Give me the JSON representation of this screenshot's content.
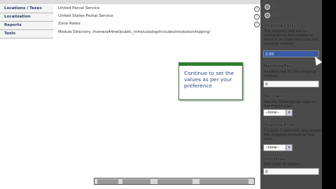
{
  "nav": {
    "items": [
      {
        "label": "Locations / Taxes"
      },
      {
        "label": "Localization"
      },
      {
        "label": "Reports"
      },
      {
        "label": "Tools"
      }
    ]
  },
  "modules": {
    "rows": [
      {
        "name": "United Parcel Service"
      },
      {
        "name": "United States Postal Service"
      },
      {
        "name": "Zone Rates"
      }
    ],
    "directory": "Module Directory: /home/a44net/public_html/catalog/includes/modules/shipping/"
  },
  "tooltip": {
    "text": "Continue to set the values as per your preference"
  },
  "sidepanel": {
    "radio1": "True",
    "radio2": "False",
    "shipping_cost_label": "Shipping Cost",
    "shipping_cost_desc": "The shipping cost will be multiplied by the number of items in an order that uses this shipping method.",
    "shipping_cost_value": "2.50",
    "handling_fee_label": "Handling Fee",
    "handling_fee_desc": "Handling fee for this shipping method.",
    "handling_fee_value": "0",
    "tax_class_label": "Tax Class",
    "tax_class_desc": "Use the following tax class on the shipping fee.",
    "tax_class_value": "--none--",
    "shipping_zone_label": "Shipping Zone",
    "shipping_zone_desc": "If a zone is selected, only enable this shipping method for that zone.",
    "shipping_zone_value": "--none--",
    "sort_order_label": "Sort Order",
    "sort_order_desc": "Sort order of display.",
    "sort_order_value": "0"
  }
}
